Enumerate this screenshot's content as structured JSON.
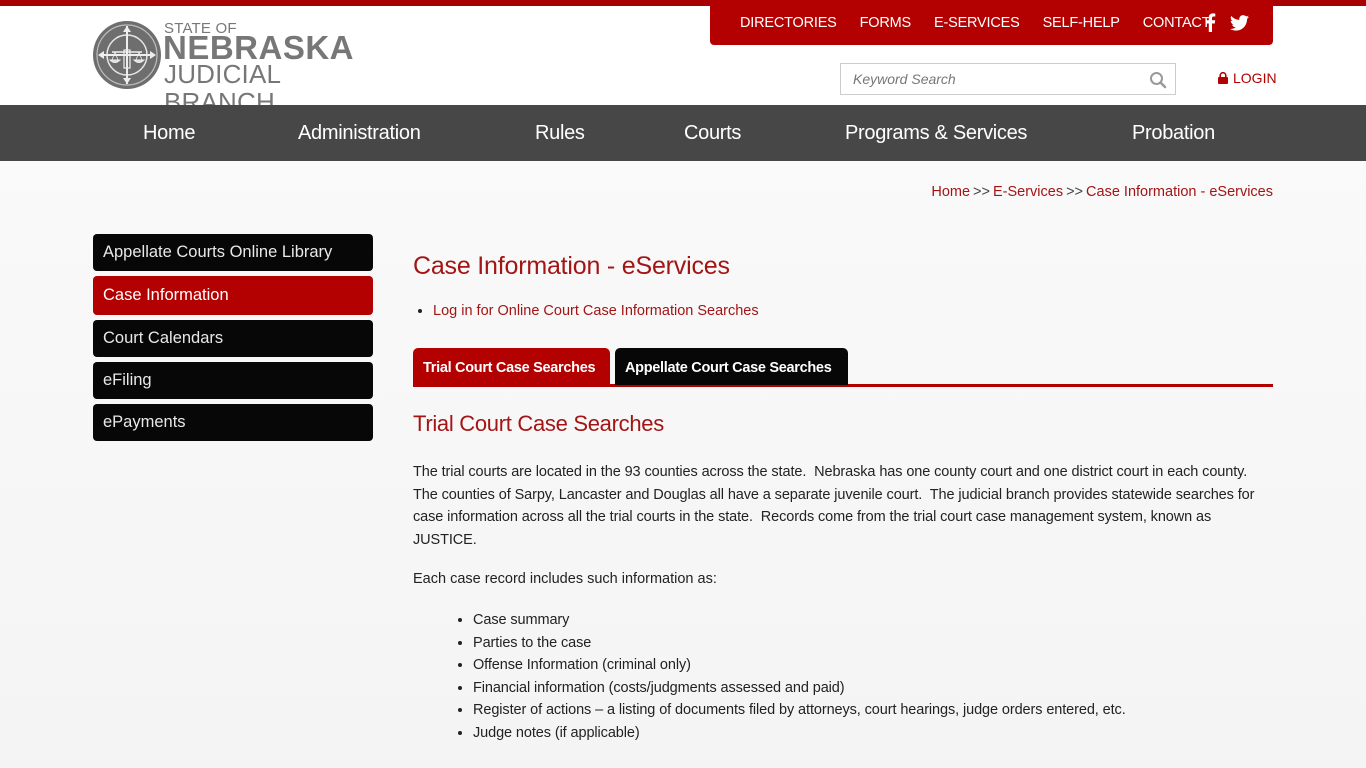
{
  "branding": {
    "accent_color": "#b30000",
    "logo_line1": "STATE OF",
    "logo_line2": "NEBRASKA",
    "logo_line3": "JUDICIAL BRANCH"
  },
  "utility_nav": {
    "items": [
      {
        "label": "DIRECTORIES"
      },
      {
        "label": "FORMS"
      },
      {
        "label": "E-SERVICES"
      },
      {
        "label": "SELF-HELP"
      },
      {
        "label": "CONTACT"
      }
    ],
    "social": [
      "facebook-icon",
      "twitter-icon"
    ]
  },
  "search": {
    "placeholder": "Keyword Search",
    "value": ""
  },
  "login": {
    "label": "LOGIN",
    "icon": "lock-icon"
  },
  "main_nav": {
    "items": [
      {
        "label": "Home"
      },
      {
        "label": "Administration"
      },
      {
        "label": "Rules"
      },
      {
        "label": "Courts"
      },
      {
        "label": "Programs & Services"
      },
      {
        "label": "Probation"
      }
    ]
  },
  "breadcrumb": {
    "items": [
      {
        "label": "Home"
      },
      {
        "label": "E-Services"
      },
      {
        "label": "Case Information - eServices"
      }
    ],
    "separator": ">>"
  },
  "sidebar": {
    "items": [
      {
        "label": "Appellate Courts Online Library",
        "active": false
      },
      {
        "label": "Case Information",
        "active": true
      },
      {
        "label": "Court Calendars",
        "active": false
      },
      {
        "label": "eFiling",
        "active": false
      },
      {
        "label": "ePayments",
        "active": false
      }
    ]
  },
  "content": {
    "title": "Case Information - eServices",
    "links": [
      {
        "label": "Log in for Online Court Case Information Searches"
      }
    ],
    "tabs": [
      {
        "label": "Trial Court Case Searches",
        "active": true
      },
      {
        "label": "Appellate Court Case Searches",
        "active": false
      }
    ],
    "section_title": "Trial Court Case Searches",
    "paragraph": "The trial courts are located in the 93 counties across the state.  Nebraska has one county court and one district court in each county.  The counties of Sarpy, Lancaster and Douglas all have a separate juvenile court.  The judicial branch provides statewide searches for case information across all the trial courts in the state.  Records come from the trial court case management system, known as JUSTICE.",
    "intro": "Each case record includes such information as:",
    "info_items": [
      "Case summary",
      "Parties to the case",
      "Offense Information (criminal only)",
      "Financial information (costs/judgments assessed and paid)",
      "Register of actions – a listing of documents filed by attorneys, court hearings, judge orders entered, etc.",
      "Judge notes (if applicable)"
    ]
  }
}
